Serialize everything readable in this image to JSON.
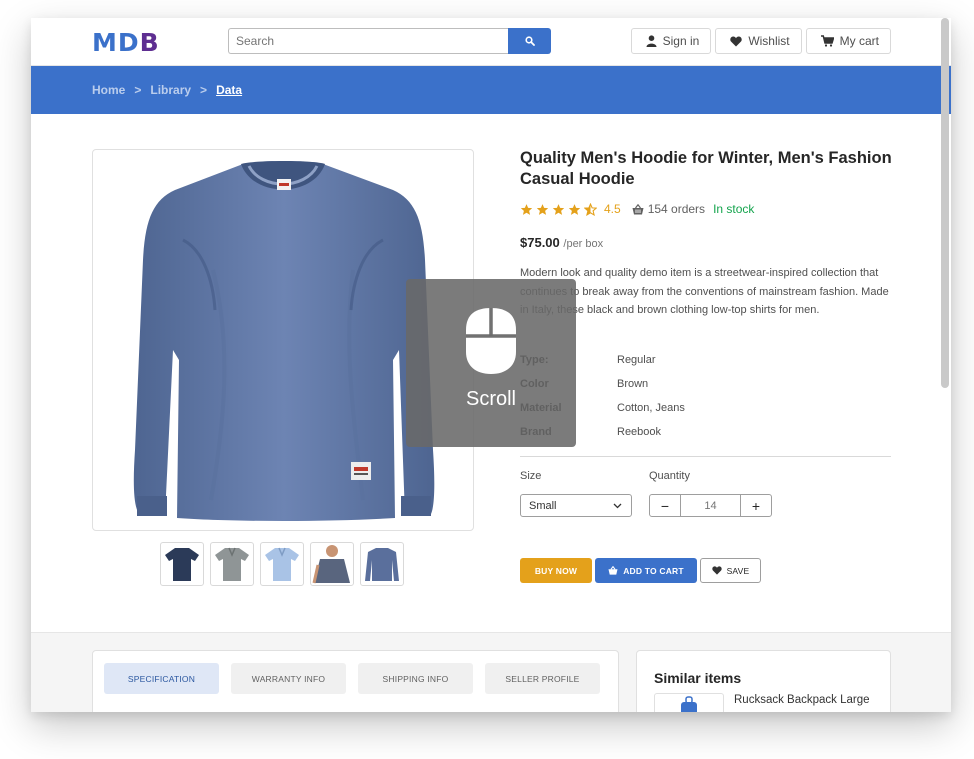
{
  "header": {
    "logo": {
      "m": "M",
      "d": "D",
      "b": "B"
    },
    "search": {
      "placeholder": "Search"
    },
    "buttons": {
      "sign_in": "Sign in",
      "wishlist": "Wishlist",
      "cart": "My cart"
    }
  },
  "breadcrumb": {
    "items": [
      "Home",
      "Library",
      "Data"
    ],
    "separator": ">"
  },
  "product": {
    "title": "Quality Men's Hoodie for Winter, Men's Fashion Casual Hoodie",
    "rating": "4.5",
    "rating_stars": 4.5,
    "orders": "154 orders",
    "stock": "In stock",
    "price": "$75.00",
    "price_unit": "/per box",
    "description": "Modern look and quality demo item is a streetwear-inspired collection that continues to break away from the conventions of mainstream fashion. Made in Italy, these black and brown clothing low-top shirts for men.",
    "specs": [
      {
        "key": "Type:",
        "value": "Regular"
      },
      {
        "key": "Color",
        "value": "Brown"
      },
      {
        "key": "Material",
        "value": "Cotton, Jeans"
      },
      {
        "key": "Brand",
        "value": "Reebook"
      }
    ],
    "size_label": "Size",
    "size_value": "Small",
    "quantity_label": "Quantity",
    "quantity_value": "14",
    "qty_minus": "−",
    "qty_plus": "+",
    "actions": {
      "buy": "BUY NOW",
      "add_to_cart": "ADD TO CART",
      "save": "SAVE"
    }
  },
  "tabs": [
    "SPECIFICATION",
    "WARRANTY INFO",
    "SHIPPING INFO",
    "SELLER PROFILE"
  ],
  "similar": {
    "title": "Similar items",
    "first_item": "Rucksack Backpack Large"
  },
  "overlay": {
    "label": "Scroll"
  },
  "colors": {
    "primary": "#3b71ca",
    "warning": "#e4a11b",
    "success": "#14a44d",
    "logo_purple": "#5e2e91"
  },
  "icons": [
    "search-icon",
    "user-icon",
    "heart-icon",
    "cart-icon",
    "basket-icon",
    "mouse-icon",
    "chevron-down-icon",
    "star-icon"
  ]
}
